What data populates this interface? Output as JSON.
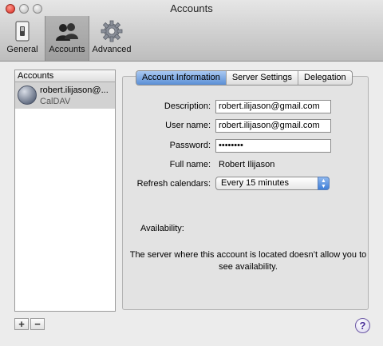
{
  "window": {
    "title": "Accounts"
  },
  "toolbar": {
    "items": [
      {
        "label": "General",
        "icon": "switch-icon",
        "selected": false
      },
      {
        "label": "Accounts",
        "icon": "people-icon",
        "selected": true
      },
      {
        "label": "Advanced",
        "icon": "gear-icon",
        "selected": false
      }
    ]
  },
  "sidebar": {
    "header": "Accounts",
    "account": {
      "name": "robert.ilijason@...",
      "type": "CalDAV",
      "icon": "globe-icon"
    },
    "add_label": "+",
    "remove_label": "−"
  },
  "tabs": [
    {
      "label": "Account Information",
      "active": true
    },
    {
      "label": "Server Settings",
      "active": false
    },
    {
      "label": "Delegation",
      "active": false
    }
  ],
  "form": {
    "description_label": "Description:",
    "description_value": "robert.ilijason@gmail.com",
    "username_label": "User name:",
    "username_value": "robert.ilijason@gmail.com",
    "password_label": "Password:",
    "password_value": "••••••••",
    "fullname_label": "Full name:",
    "fullname_value": "Robert Ilijason",
    "refresh_label": "Refresh calendars:",
    "refresh_value": "Every 15 minutes"
  },
  "availability": {
    "label": "Availability:",
    "message": "The server where this account is located doesn’t allow you to see availability."
  },
  "help_label": "?",
  "colors": {
    "selected_tab": "#5b8fd6",
    "close_button": "#d9261c",
    "popup_arrows": "#3f7fd8"
  }
}
